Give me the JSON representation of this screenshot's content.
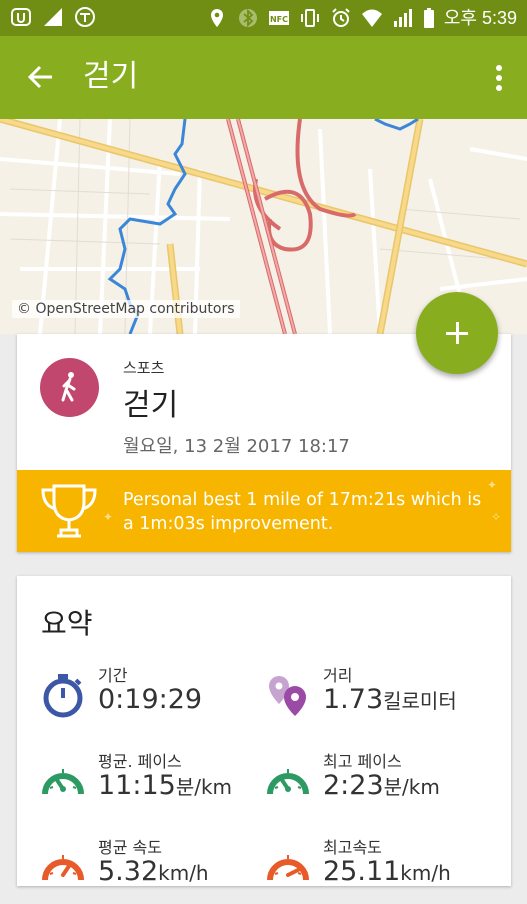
{
  "status_bar": {
    "time": "오후 5:39",
    "nfc_label": "NFC"
  },
  "app_bar": {
    "title": "걷기"
  },
  "map": {
    "attribution": "© OpenStreetMap contributors",
    "route_color": "#3a86d8"
  },
  "activity": {
    "category": "스포츠",
    "name": "걷기",
    "date": "월요일, 13 2월 2017 18:17",
    "avatar_color": "#c2476e"
  },
  "personal_best": {
    "text": "Personal best 1 mile of 17m:21s which is a 1m:03s improvement."
  },
  "summary": {
    "title": "요약",
    "duration": {
      "label": "기간",
      "value": "0:19:29"
    },
    "distance": {
      "label": "거리",
      "value": "1.73",
      "unit": "킬로미터"
    },
    "avg_pace": {
      "label": "평균. 페이스",
      "value": "11:15",
      "unit_a": "분",
      "unit_b": "/km"
    },
    "best_pace": {
      "label": "최고 페이스",
      "value": "2:23",
      "unit_a": "분",
      "unit_b": "/km"
    },
    "avg_speed": {
      "label": "평균 속도",
      "value": "5.32",
      "unit": "km/h"
    },
    "max_speed": {
      "label": "최고속도",
      "value": "25.11",
      "unit": "km/h"
    }
  },
  "colors": {
    "status_bar": "#6f8e13",
    "app_bar": "#88ae1f",
    "personal_best_bg": "#f7b500",
    "pace_icon": "#2e9a63",
    "speed_icon": "#e85a2a",
    "duration_icon": "#3b57a6",
    "distance_icon": "#9b4aa6"
  }
}
